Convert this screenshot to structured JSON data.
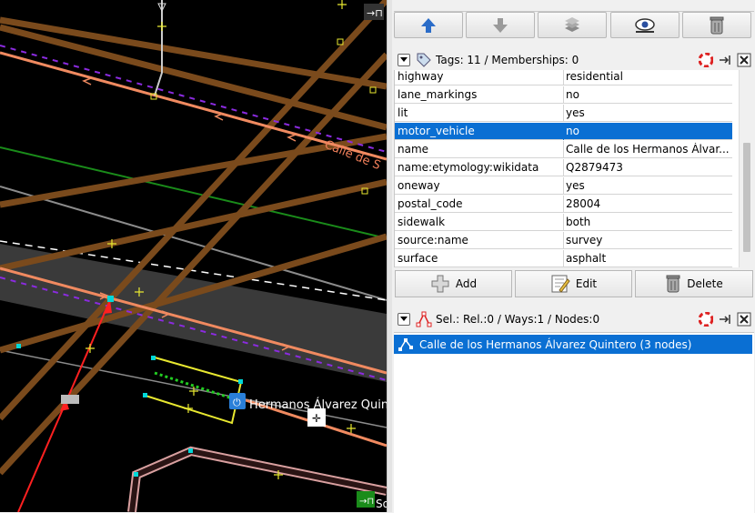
{
  "map": {
    "street_label": "Calle de S",
    "poi_label": "Hermanos Álvarez Quint",
    "poi_label_bottom": "So",
    "colors": {
      "background": "#000000",
      "road_brown": "#7a4a1c",
      "road_salmon": "#f08a60",
      "selected_way": "#404040",
      "purple_dash": "#8b2be0"
    }
  },
  "toolbar": {
    "buttons": [
      {
        "name": "move-up-button",
        "icon": "arrow-up-icon"
      },
      {
        "name": "move-down-button",
        "icon": "arrow-down-icon"
      },
      {
        "name": "layers-button",
        "icon": "layers-icon"
      },
      {
        "name": "visibility-button",
        "icon": "eye-icon"
      },
      {
        "name": "delete-layer-button",
        "icon": "trash-icon"
      }
    ]
  },
  "tags_panel": {
    "title": "Tags: 11 / Memberships: 0",
    "rows": [
      {
        "key": "highway",
        "value": "residential"
      },
      {
        "key": "lane_markings",
        "value": "no"
      },
      {
        "key": "lit",
        "value": "yes"
      },
      {
        "key": "motor_vehicle",
        "value": "no"
      },
      {
        "key": "name",
        "value": "Calle de los Hermanos Álvar..."
      },
      {
        "key": "name:etymology:wikidata",
        "value": "Q2879473"
      },
      {
        "key": "oneway",
        "value": "yes"
      },
      {
        "key": "postal_code",
        "value": "28004"
      },
      {
        "key": "sidewalk",
        "value": "both"
      },
      {
        "key": "source:name",
        "value": "survey"
      },
      {
        "key": "surface",
        "value": "asphalt"
      }
    ],
    "selected_row_index": 3,
    "add_label": "Add",
    "edit_label": "Edit",
    "delete_label": "Delete"
  },
  "selection_panel": {
    "title": "Sel.: Rel.:0 / Ways:1 / Nodes:0",
    "items": [
      {
        "label": "Calle de los Hermanos Álvarez Quintero (3 nodes)"
      }
    ]
  },
  "colors": {
    "selection_blue": "#0a6fd3",
    "panel_bg": "#f0f0f0"
  }
}
